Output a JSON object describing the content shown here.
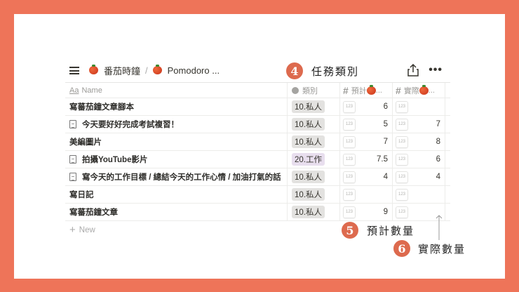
{
  "breadcrumb": {
    "page1": "番茄時鐘",
    "page2": "Pomodoro ..."
  },
  "columns": {
    "name": "Name",
    "name_icon": "Aa",
    "category": "類別",
    "estimated": "預計",
    "actual": "實際",
    "ellipsis": "..."
  },
  "rows": [
    {
      "name": "寫蕃茄鐘文章腳本",
      "doc": false,
      "category": "10.私人",
      "work": false,
      "est": "6",
      "act": ""
    },
    {
      "name": "今天要好好完成考試複習！",
      "doc": true,
      "category": "10.私人",
      "work": false,
      "est": "5",
      "act": "7"
    },
    {
      "name": "美編圖片",
      "doc": false,
      "category": "10.私人",
      "work": false,
      "est": "7",
      "act": "8"
    },
    {
      "name": "拍攝YouTube影片",
      "doc": true,
      "category": "20.工作",
      "work": true,
      "est": "7.5",
      "act": "6"
    },
    {
      "name": "寫今天的工作目標 / 總結今天的工作心情 / 加油打氣的話",
      "doc": true,
      "category": "10.私人",
      "work": false,
      "est": "4",
      "act": "4"
    },
    {
      "name": "寫日記",
      "doc": false,
      "category": "10.私人",
      "work": false,
      "est": "",
      "act": ""
    },
    {
      "name": "寫蕃茄鐘文章",
      "doc": false,
      "category": "10.私人",
      "work": false,
      "est": "9",
      "act": ""
    }
  ],
  "num_badge": "123",
  "new_label": "New",
  "annotations": [
    {
      "num": "4",
      "text": "任務類別"
    },
    {
      "num": "5",
      "text": "預計數量"
    },
    {
      "num": "6",
      "text": "實際數量"
    }
  ]
}
